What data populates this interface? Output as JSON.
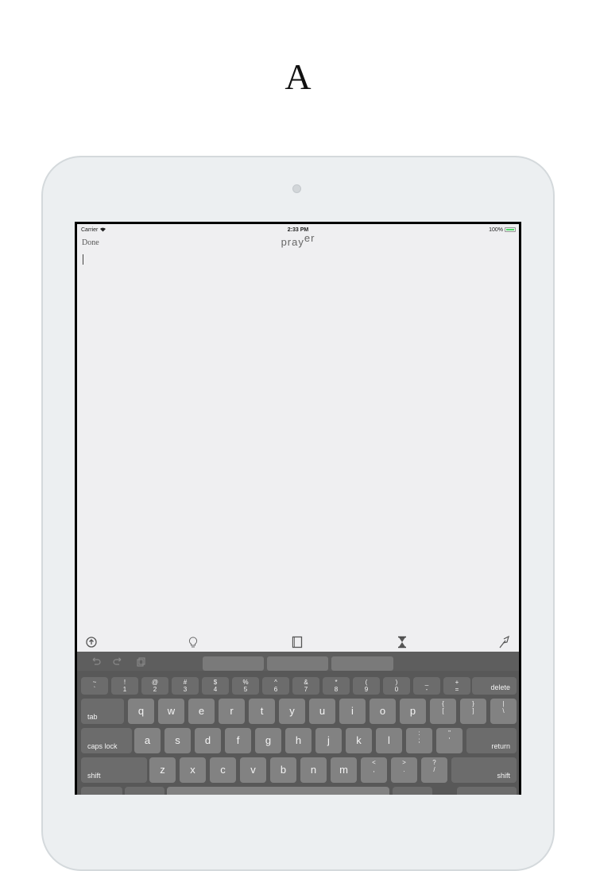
{
  "page": {
    "letter": "A"
  },
  "status": {
    "carrier": "Carrier",
    "time": "2:33 PM",
    "battery": "100%"
  },
  "nav": {
    "done_label": "Done",
    "title_main": "pray",
    "title_sup": "er"
  },
  "toolbar": {
    "icons": [
      "up-arrow-icon",
      "lightbulb-icon",
      "book-icon",
      "hourglass-icon",
      "quill-icon"
    ]
  },
  "keyboard": {
    "shortcut_icons": [
      "undo-icon",
      "redo-icon",
      "paste-icon"
    ],
    "row1": [
      {
        "top": "~",
        "bot": "`"
      },
      {
        "top": "!",
        "bot": "1"
      },
      {
        "top": "@",
        "bot": "2"
      },
      {
        "top": "#",
        "bot": "3"
      },
      {
        "top": "$",
        "bot": "4"
      },
      {
        "top": "%",
        "bot": "5"
      },
      {
        "top": "^",
        "bot": "6"
      },
      {
        "top": "&",
        "bot": "7"
      },
      {
        "top": "*",
        "bot": "8"
      },
      {
        "top": "(",
        "bot": "9"
      },
      {
        "top": ")",
        "bot": "0"
      },
      {
        "top": "_",
        "bot": "-"
      },
      {
        "top": "+",
        "bot": "="
      }
    ],
    "delete": "delete",
    "tab": "tab",
    "row2": [
      "q",
      "w",
      "e",
      "r",
      "t",
      "y",
      "u",
      "i",
      "o",
      "p"
    ],
    "row2_sym": [
      {
        "top": "{",
        "bot": "["
      },
      {
        "top": "}",
        "bot": "]"
      },
      {
        "top": "|",
        "bot": "\\"
      }
    ],
    "caps_lock": "caps lock",
    "row3": [
      "a",
      "s",
      "d",
      "f",
      "g",
      "h",
      "j",
      "k",
      "l"
    ],
    "row3_sym": [
      {
        "top": ":",
        "bot": ";"
      },
      {
        "top": "\"",
        "bot": "'"
      }
    ],
    "return": "return",
    "shift_left": "shift",
    "row4": [
      "z",
      "x",
      "c",
      "v",
      "b",
      "n",
      "m"
    ],
    "row4_sym": [
      {
        "top": "<",
        "bot": ","
      },
      {
        "top": ">",
        "bot": "."
      },
      {
        "top": "?",
        "bot": "/"
      }
    ],
    "shift_right": "shift"
  },
  "colors": {
    "battery": "#4cd964",
    "keyboard_bg": "#585858",
    "key": "#828282"
  }
}
